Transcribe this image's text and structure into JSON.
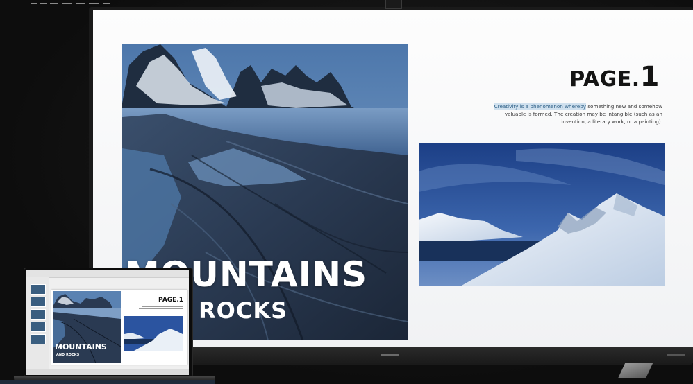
{
  "slide": {
    "page_label": "PAGE.",
    "page_number": "1",
    "description_highlight": "Creativity is a phenomenon whereby",
    "description_rest": " something new and somehow valuable is formed. The creation may be intangible (such as an invention, a literary work, or a painting).",
    "title_main": "MOUNTAINS",
    "title_sub": "ROCKS"
  },
  "laptop_preview": {
    "page_label": "PAGE.1",
    "title_main": "MOUNTAINS",
    "title_sub": "AND ROCKS"
  },
  "colors": {
    "desk": "#121212",
    "slide_bg": "#f6f7f9",
    "highlight_bg": "#cfe0ee",
    "highlight_text": "#2d5f86",
    "photo_dark": "#1d2e45",
    "photo_sky": "#5f85b4"
  },
  "icons": {
    "thumbnail_rail": "slide-thumbnail-icon",
    "webcam": "webcam-icon"
  }
}
